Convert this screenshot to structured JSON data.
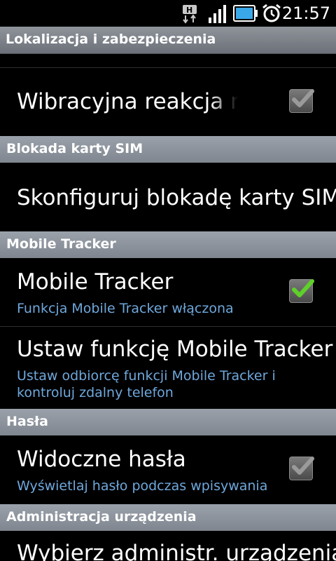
{
  "status_bar": {
    "time": "21:57",
    "network_label": "H",
    "icons": [
      "hsdpa-icon",
      "signal-icon",
      "battery-icon",
      "alarm-icon"
    ]
  },
  "title_bar": {
    "title": "Lokalizacja i zabezpieczenia"
  },
  "rows": {
    "vibration": {
      "title": "Wibracyjna reakcja na dotyk",
      "checked": true,
      "enabled": false
    },
    "sim_header": "Blokada karty SIM",
    "sim_lock": {
      "title": "Skonfiguruj blokadę karty SIM"
    },
    "tracker_header": "Mobile Tracker",
    "tracker": {
      "title": "Mobile Tracker",
      "summary": "Funkcja Mobile Tracker włączona",
      "checked": true,
      "enabled": true
    },
    "tracker_setup": {
      "title": "Ustaw funkcję Mobile Tracker",
      "summary": "Ustaw odbiorcę funkcji Mobile Tracker i kontroluj zdalny telefon"
    },
    "passwords_header": "Hasła",
    "visible_passwords": {
      "title": "Widoczne hasła",
      "summary": "Wyświetlaj hasło podczas wpisywania",
      "checked": true,
      "enabled": false
    },
    "admin_header": "Administracja urządzenia",
    "admin_select": {
      "title": "Wybierz administr. urządzenia"
    }
  },
  "colors": {
    "summary_text": "#6fa8dc",
    "check_green": "#5fd02a",
    "check_gray": "#9a9a9a"
  }
}
